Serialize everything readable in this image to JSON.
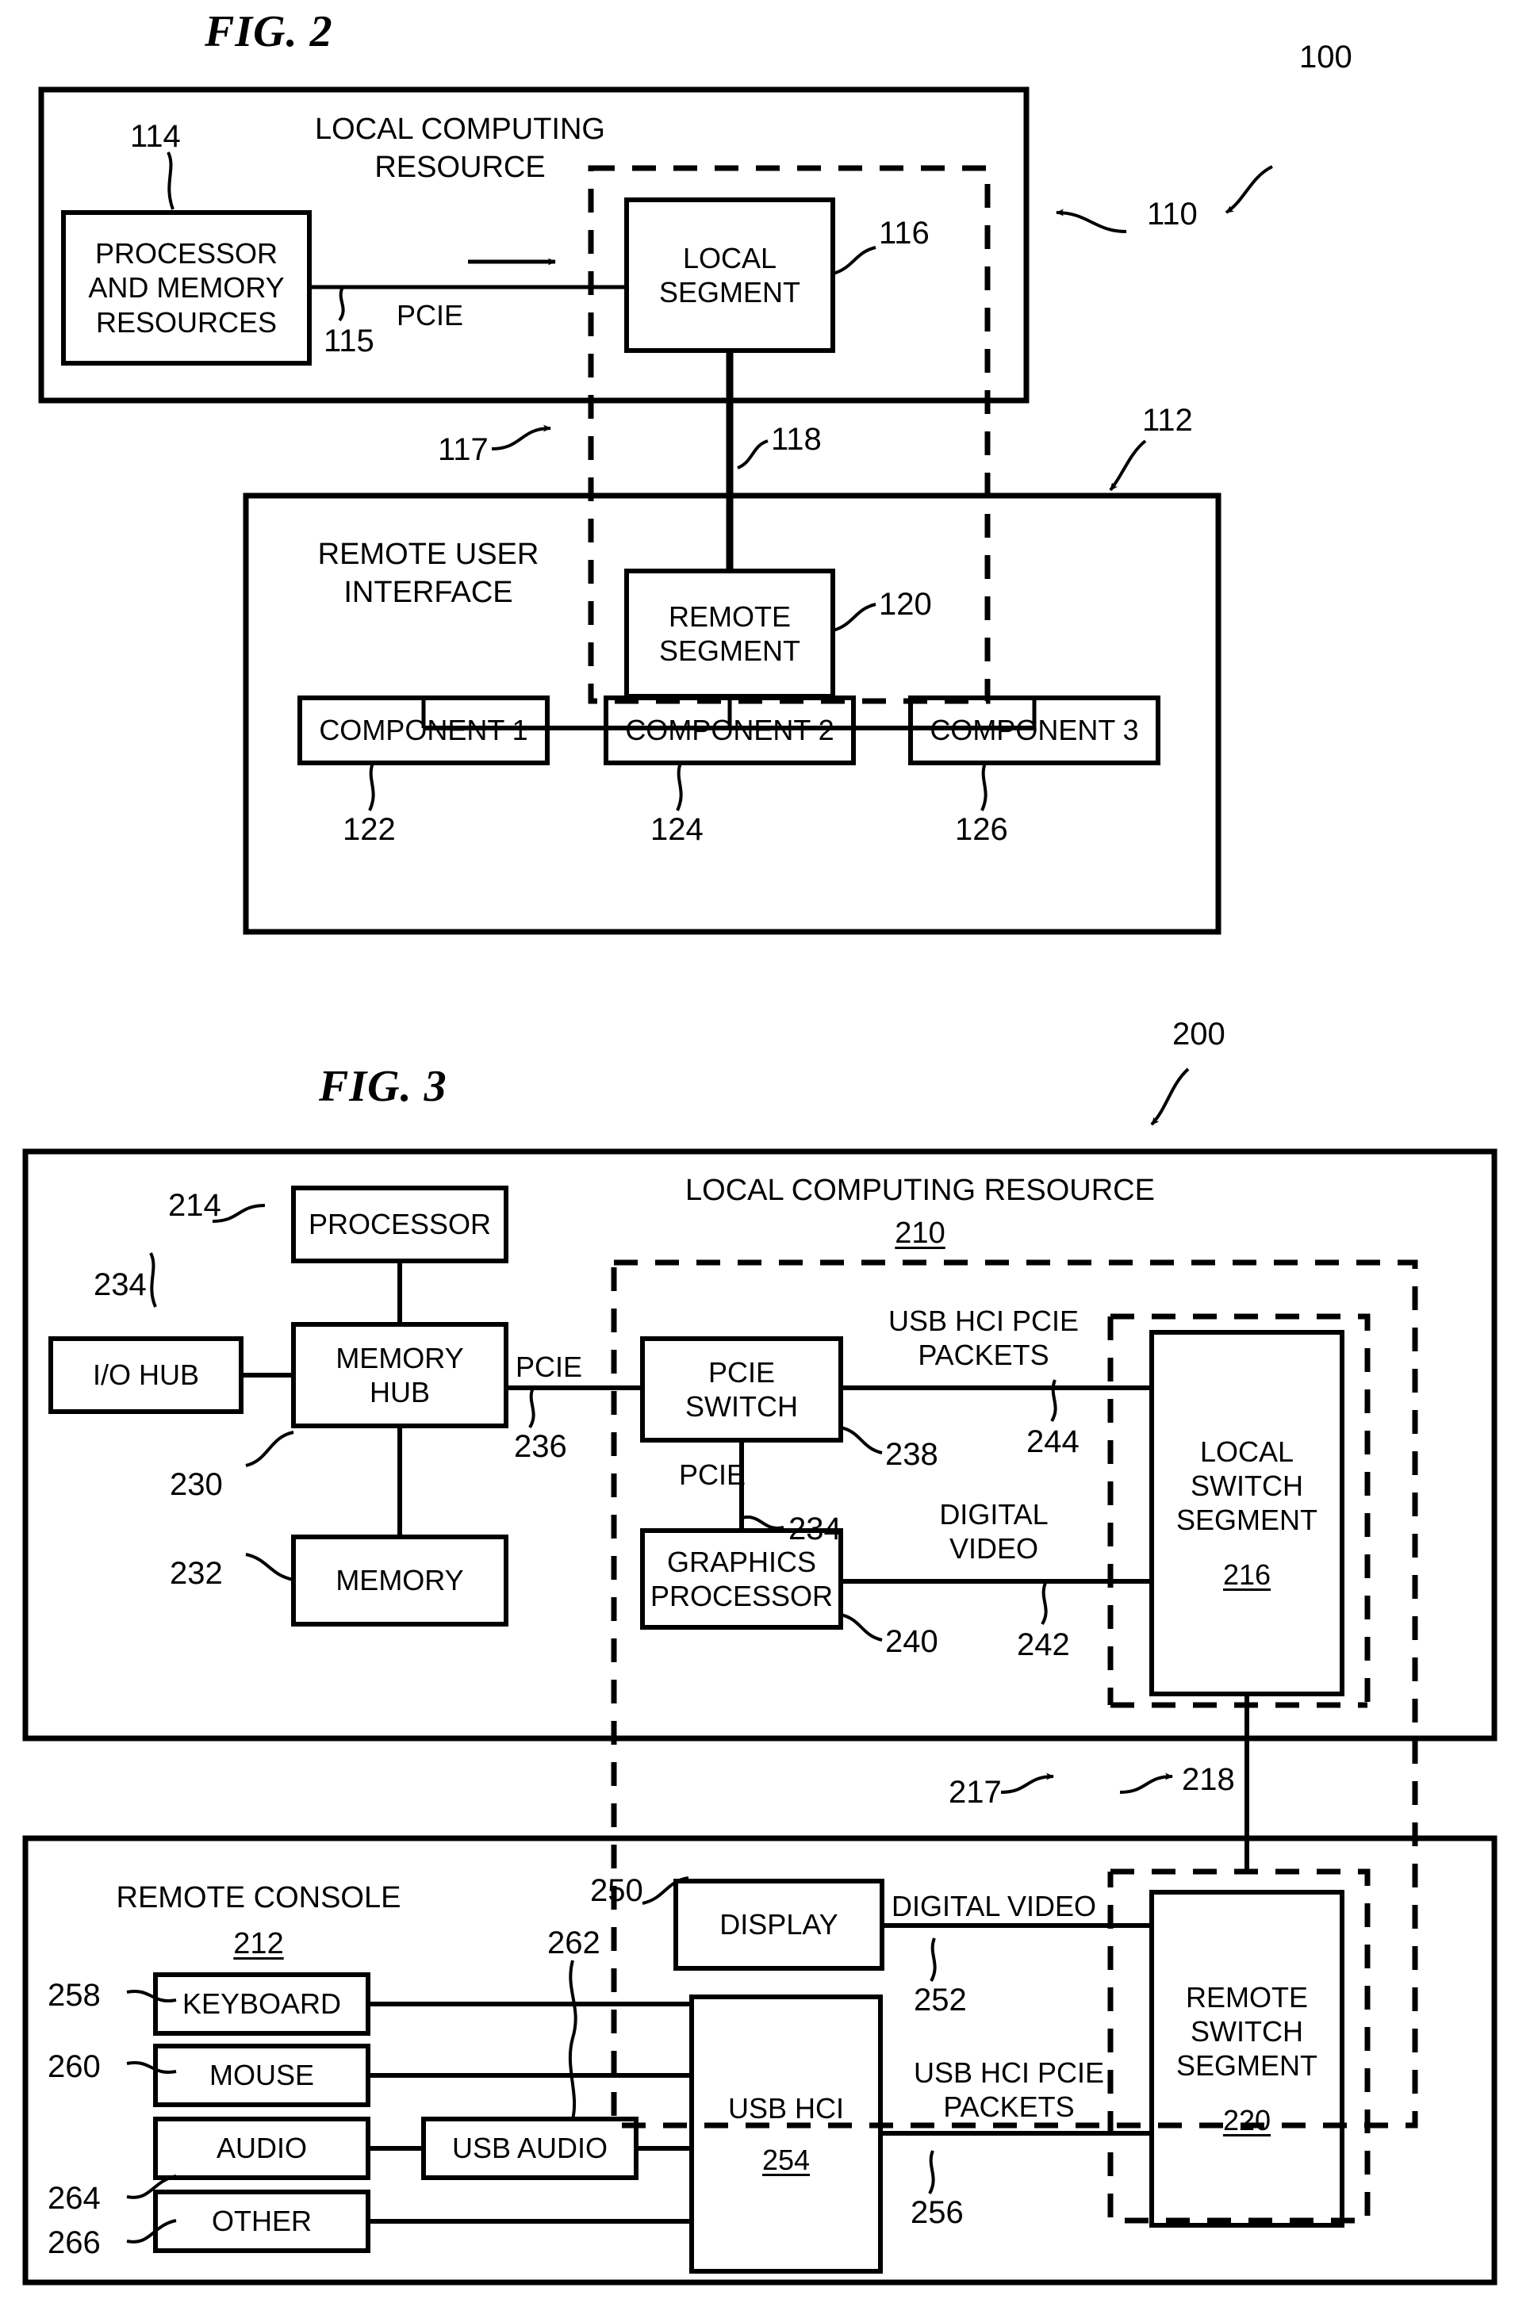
{
  "figures": [
    {
      "id": "fig2",
      "title": "FIG. 2",
      "system_ref": "100",
      "outer_boxes": [
        {
          "name": "local-computing-resource",
          "title": "LOCAL COMPUTING\nRESOURCE",
          "ref": "110"
        },
        {
          "name": "remote-user-interface",
          "title": "REMOTE USER\nINTERFACE",
          "ref": "112"
        }
      ],
      "blocks": [
        {
          "name": "processor-and-memory-resources",
          "label": "PROCESSOR\nAND MEMORY\nRESOURCES",
          "ref": "114"
        },
        {
          "name": "local-segment",
          "label": "LOCAL\nSEGMENT",
          "ref": "116"
        },
        {
          "name": "remote-segment",
          "label": "REMOTE\nSEGMENT",
          "ref": "120"
        },
        {
          "name": "component-1",
          "label": "COMPONENT 1",
          "ref": "122"
        },
        {
          "name": "component-2",
          "label": "COMPONENT 2",
          "ref": "124"
        },
        {
          "name": "component-3",
          "label": "COMPONENT 3",
          "ref": "126"
        }
      ],
      "links": [
        {
          "name": "pcie-link",
          "label": "PCIE",
          "ref": "115"
        },
        {
          "name": "switch-boundary",
          "label": "",
          "ref": "117"
        },
        {
          "name": "segment-interconnect",
          "label": "",
          "ref": "118"
        }
      ]
    },
    {
      "id": "fig3",
      "title": "FIG. 3",
      "system_ref": "200",
      "outer_boxes": [
        {
          "name": "local-computing-resource",
          "title": "LOCAL COMPUTING RESOURCE",
          "ref": "210"
        },
        {
          "name": "remote-console",
          "title": "REMOTE CONSOLE",
          "ref": "212"
        }
      ],
      "blocks": [
        {
          "name": "processor",
          "label": "PROCESSOR",
          "ref": "214"
        },
        {
          "name": "io-hub",
          "label": "I/O HUB",
          "ref": "234"
        },
        {
          "name": "memory-hub",
          "label": "MEMORY\nHUB",
          "ref": "230"
        },
        {
          "name": "memory",
          "label": "MEMORY",
          "ref": "232"
        },
        {
          "name": "pcie-switch",
          "label": "PCIE\nSWITCH",
          "ref": "238"
        },
        {
          "name": "graphics-processor",
          "label": "GRAPHICS\nPROCESSOR",
          "ref": "240"
        },
        {
          "name": "local-switch-segment",
          "label": "LOCAL\nSWITCH\nSEGMENT",
          "ref": "216"
        },
        {
          "name": "display",
          "label": "DISPLAY",
          "ref": "250"
        },
        {
          "name": "keyboard",
          "label": "KEYBOARD",
          "ref": "258"
        },
        {
          "name": "mouse",
          "label": "MOUSE",
          "ref": "260"
        },
        {
          "name": "audio",
          "label": "AUDIO",
          "ref": "264"
        },
        {
          "name": "other",
          "label": "OTHER",
          "ref": "266"
        },
        {
          "name": "usb-audio",
          "label": "USB AUDIO",
          "ref": "262"
        },
        {
          "name": "usb-hci",
          "label": "USB HCI",
          "ref": "254"
        },
        {
          "name": "remote-switch-segment",
          "label": "REMOTE\nSWITCH\nSEGMENT",
          "ref": "220"
        }
      ],
      "links": [
        {
          "name": "memoryhub-pcie",
          "label": "PCIE",
          "ref": "236"
        },
        {
          "name": "switch-graphics-pcie",
          "label": "PCIE",
          "ref": "234"
        },
        {
          "name": "usb-hci-pcie-packets-local",
          "label": "USB HCI PCIE\nPACKETS",
          "ref": "244"
        },
        {
          "name": "digital-video-local",
          "label": "DIGITAL\nVIDEO",
          "ref": "242"
        },
        {
          "name": "switch-boundary",
          "label": "",
          "ref": "217"
        },
        {
          "name": "segment-interconnect",
          "label": "",
          "ref": "218"
        },
        {
          "name": "digital-video-remote",
          "label": "DIGITAL VIDEO",
          "ref": "252"
        },
        {
          "name": "usb-hci-pcie-packets-remote",
          "label": "USB HCI PCIE\nPACKETS",
          "ref": "256"
        }
      ]
    }
  ],
  "fig2": {
    "title": "FIG. 2",
    "ref_100": "100",
    "ref_110": "110",
    "ref_112": "112",
    "ref_114": "114",
    "ref_115": "115",
    "ref_116": "116",
    "ref_117": "117",
    "ref_118": "118",
    "ref_120": "120",
    "ref_122": "122",
    "ref_124": "124",
    "ref_126": "126",
    "lcr_title_l1": "LOCAL COMPUTING",
    "lcr_title_l2": "RESOURCE",
    "rui_title_l1": "REMOTE USER",
    "rui_title_l2": "INTERFACE",
    "proc_mem_l1": "PROCESSOR",
    "proc_mem_l2": "AND MEMORY",
    "proc_mem_l3": "RESOURCES",
    "local_seg_l1": "LOCAL",
    "local_seg_l2": "SEGMENT",
    "remote_seg_l1": "REMOTE",
    "remote_seg_l2": "SEGMENT",
    "pcie_label": "PCIE",
    "component1": "COMPONENT 1",
    "component2": "COMPONENT 2",
    "component3": "COMPONENT 3"
  },
  "fig3": {
    "title": "FIG. 3",
    "ref_200": "200",
    "ref_210": "210",
    "ref_212": "212",
    "ref_214": "214",
    "ref_216": "216",
    "ref_217": "217",
    "ref_218": "218",
    "ref_220": "220",
    "ref_230": "230",
    "ref_232": "232",
    "ref_234_iohub": "234",
    "ref_234_pcie": "234",
    "ref_236": "236",
    "ref_238": "238",
    "ref_240": "240",
    "ref_242": "242",
    "ref_244": "244",
    "ref_250": "250",
    "ref_252": "252",
    "ref_254": "254",
    "ref_256": "256",
    "ref_258": "258",
    "ref_260": "260",
    "ref_262": "262",
    "ref_264": "264",
    "ref_266": "266",
    "lcr_title": "LOCAL COMPUTING RESOURCE",
    "rc_title": "REMOTE CONSOLE",
    "processor": "PROCESSOR",
    "io_hub": "I/O HUB",
    "memory_hub_l1": "MEMORY",
    "memory_hub_l2": "HUB",
    "memory": "MEMORY",
    "pcie_switch_l1": "PCIE",
    "pcie_switch_l2": "SWITCH",
    "graphics_l1": "GRAPHICS",
    "graphics_l2": "PROCESSOR",
    "local_switch_l1": "LOCAL",
    "local_switch_l2": "SWITCH",
    "local_switch_l3": "SEGMENT",
    "remote_switch_l1": "REMOTE",
    "remote_switch_l2": "SWITCH",
    "remote_switch_l3": "SEGMENT",
    "display": "DISPLAY",
    "keyboard": "KEYBOARD",
    "mouse": "MOUSE",
    "audio": "AUDIO",
    "other": "OTHER",
    "usb_audio": "USB AUDIO",
    "usb_hci": "USB HCI",
    "pcie_236_label": "PCIE",
    "pcie_234_label": "PCIE",
    "usb_packets_l1": "USB HCI PCIE",
    "usb_packets_l2": "PACKETS",
    "digital_video_l1": "DIGITAL",
    "digital_video_l2": "VIDEO",
    "digital_video_remote": "DIGITAL VIDEO",
    "usb_packets_r1": "USB HCI PCIE",
    "usb_packets_r2": "PACKETS"
  }
}
